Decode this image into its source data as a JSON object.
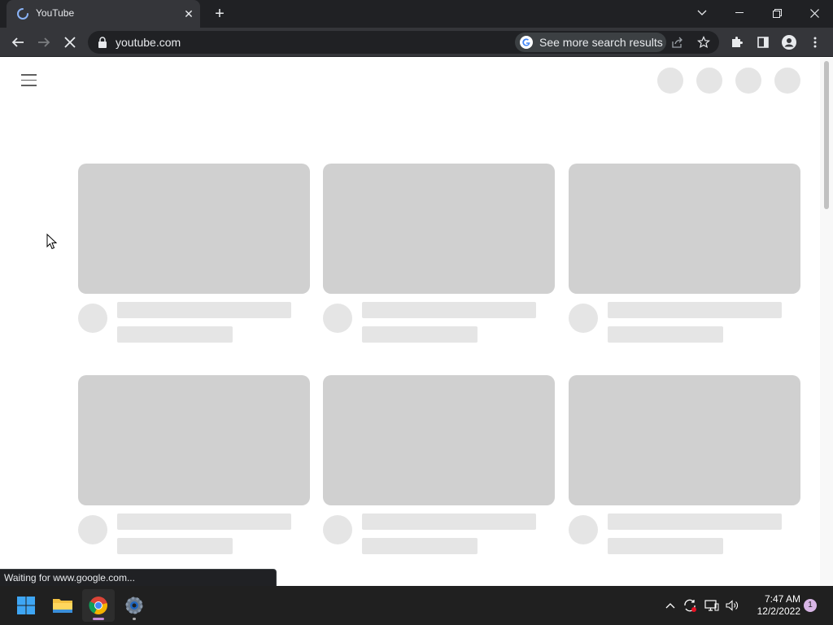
{
  "browser": {
    "tab_title": "YouTube",
    "url": "youtube.com",
    "search_chip": "See more search results",
    "status_text": "Waiting for www.google.com..."
  },
  "taskbar": {
    "time": "7:47 AM",
    "date": "12/2/2022",
    "notification_count": "1",
    "apps": [
      "start-icon",
      "file-explorer-icon",
      "chrome-icon",
      "settings-icon"
    ]
  },
  "page": {
    "state": "loading-skeleton",
    "skeleton_cards": 6
  },
  "colors": {
    "chrome_dark": "#202124",
    "chrome_toolbar": "#35363a",
    "skeleton_thumb": "#d0d0d0",
    "skeleton_line": "#e5e5e5",
    "taskbar": "#202020"
  }
}
